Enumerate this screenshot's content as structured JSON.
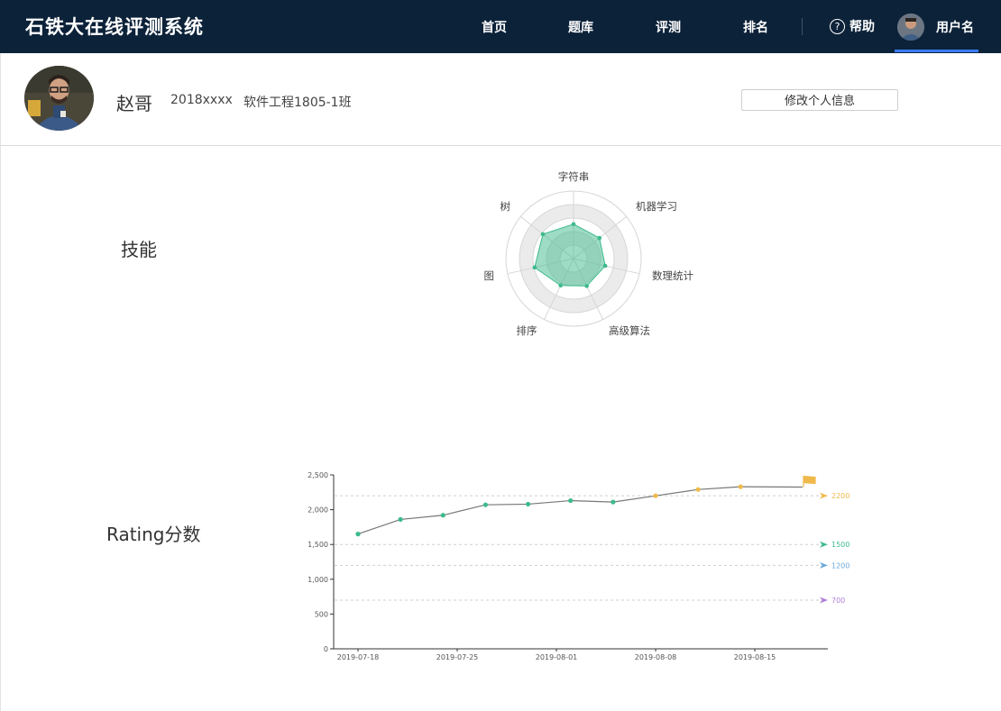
{
  "header": {
    "brand": "石铁大在线评测系统",
    "nav": [
      {
        "label": "首页"
      },
      {
        "label": "题库"
      },
      {
        "label": "评测"
      },
      {
        "label": "排名"
      }
    ],
    "help_label": "帮助",
    "help_icon": "?",
    "username": "用户名"
  },
  "profile": {
    "name": "赵哥",
    "student_id": "2018xxxx",
    "class_name": "软件工程1805-1班",
    "edit_button": "修改个人信息"
  },
  "skills": {
    "title": "技能"
  },
  "rating": {
    "title": "Rating分数"
  },
  "chart_data": [
    {
      "type": "radar",
      "title": "",
      "indicators": [
        "字符串",
        "机器学习",
        "数理统计",
        "高级算法",
        "排序",
        "图",
        "树"
      ],
      "values": [
        0.51,
        0.49,
        0.48,
        0.45,
        0.44,
        0.59,
        0.58
      ],
      "max": 1,
      "color": "#3dba8c"
    },
    {
      "type": "line",
      "title": "",
      "x": [
        "2019-07-18",
        "2019-07-21",
        "2019-07-24",
        "2019-07-27",
        "2019-07-30",
        "2019-08-02",
        "2019-08-05",
        "2019-08-08",
        "2019-08-11",
        "2019-08-14"
      ],
      "x_tick_labels": [
        "2019-07-18",
        "2019-07-25",
        "2019-08-01",
        "2019-08-08",
        "2019-08-15"
      ],
      "y": [
        1650,
        1860,
        1920,
        2070,
        2080,
        2130,
        2110,
        2200,
        2290,
        2330
      ],
      "ylim": [
        0,
        2500
      ],
      "y_ticks": [
        "0",
        "500",
        "1,000",
        "1,500",
        "2,000",
        "2,500"
      ],
      "thresholds": [
        {
          "value": 2200,
          "label": "2200",
          "color": "#f0b94b"
        },
        {
          "value": 1500,
          "label": "1500",
          "color": "#3dba8c"
        },
        {
          "value": 1200,
          "label": "1200",
          "color": "#6aa7d8"
        },
        {
          "value": 700,
          "label": "700",
          "color": "#b07fd9"
        }
      ],
      "line_color": "#777777"
    }
  ]
}
